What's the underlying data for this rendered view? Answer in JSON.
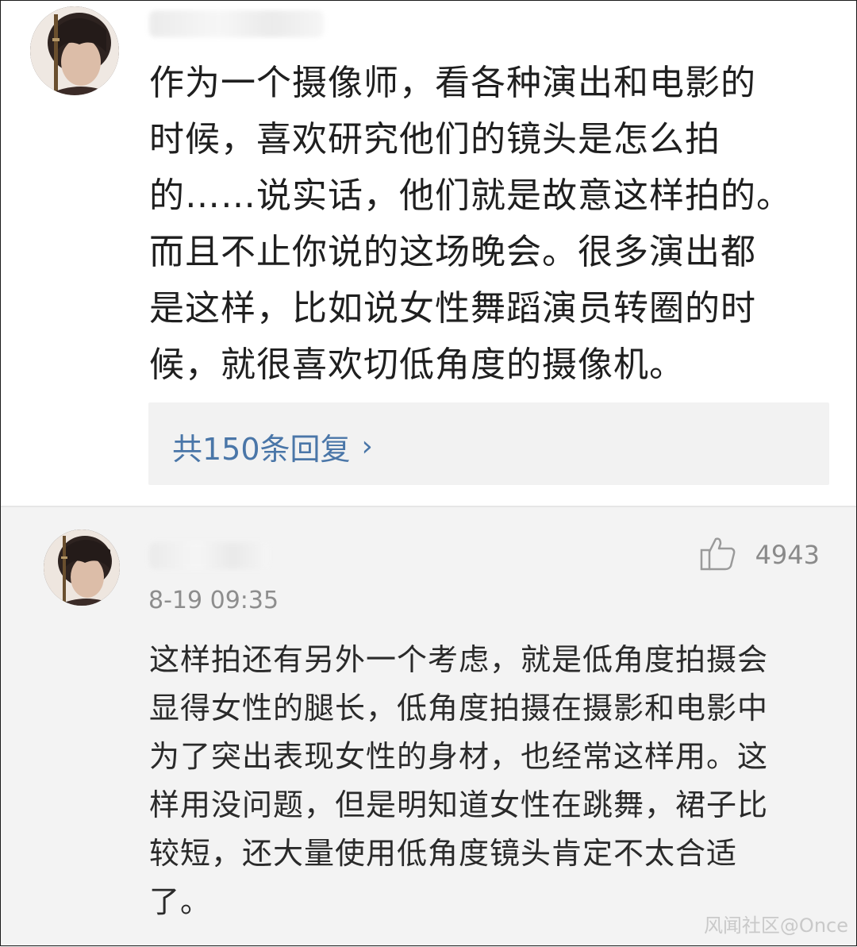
{
  "comments": [
    {
      "text": "作为一个摄像师，看各种演出和电影的\n时候，喜欢研究他们的镜头是怎么拍\n的……说实话，他们就是故意这样拍的。\n而且不止你说的这场晚会。很多演出都\n是这样，比如说女性舞蹈演员转圈的时\n候，就很喜欢切低角度的摄像机。",
      "reply_label": "共150条回复",
      "reply_chevron": "›"
    },
    {
      "likes": "4943",
      "timestamp": "8-19 09:35",
      "text": "这样拍还有另外一个考虑，就是低角度拍摄会\n显得女性的腿长，低角度拍摄在摄影和电影中\n为了突出表现女性的身材，也经常这样用。这\n样用没问题，但是明知道女性在跳舞，裙子比\n较短，还大量使用低角度镜头肯定不太合适\n了。"
    }
  ],
  "icons": {
    "like": "thumbs-up-icon",
    "reply_chevron": "chevron-right-icon"
  },
  "colors": {
    "link": "#4a76a8",
    "meta": "#8d8d8d",
    "section_bg": "#f3f3f3"
  },
  "watermark": "风闻社区@Once"
}
